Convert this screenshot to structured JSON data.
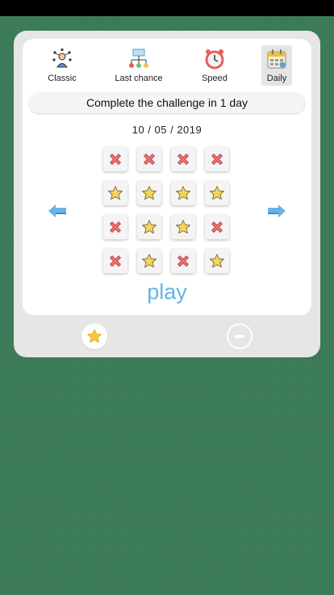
{
  "tabs": [
    {
      "label": "Classic",
      "icon": "person-presentation-icon"
    },
    {
      "label": "Last chance",
      "icon": "org-chart-icon"
    },
    {
      "label": "Speed",
      "icon": "alarm-clock-icon"
    },
    {
      "label": "Daily",
      "icon": "calendar-icon",
      "active": true
    }
  ],
  "banner": "Complete the challenge in 1 day",
  "date": "10 / 05 / 2019",
  "grid": [
    [
      "x",
      "x",
      "x",
      "x"
    ],
    [
      "star",
      "star",
      "star",
      "star"
    ],
    [
      "x",
      "star",
      "star",
      "x"
    ],
    [
      "x",
      "star",
      "x",
      "star"
    ]
  ],
  "play_label": "play",
  "colors": {
    "background": "#3b7a57",
    "accent": "#67b3e9",
    "cross": "#ea6f6f",
    "star": "#f7d35a"
  }
}
